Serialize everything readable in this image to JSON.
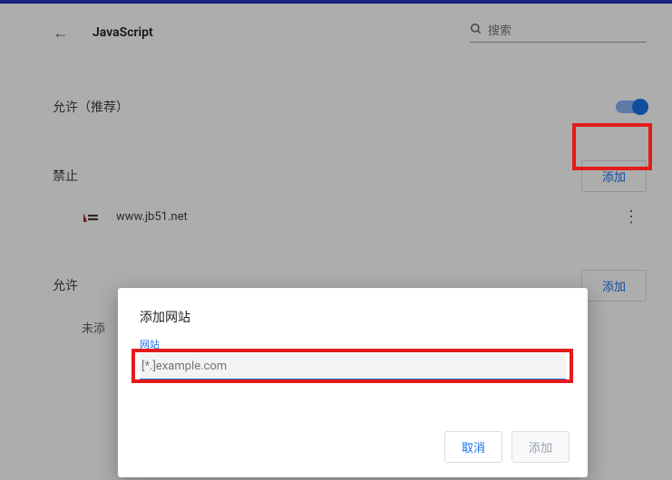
{
  "header": {
    "title": "JavaScript",
    "search_placeholder": "搜索"
  },
  "allow_recommended": {
    "label": "允许（推荐）",
    "enabled": true
  },
  "block": {
    "label": "禁止",
    "add_button": "添加",
    "sites": [
      {
        "domain": "www.jb51.net"
      }
    ]
  },
  "allow": {
    "label": "允许",
    "add_button": "添加",
    "empty_prefix": "未添"
  },
  "dialog": {
    "title": "添加网站",
    "field_label": "网站",
    "input_placeholder": "[*.]example.com",
    "input_value": "",
    "cancel": "取消",
    "confirm": "添加"
  }
}
